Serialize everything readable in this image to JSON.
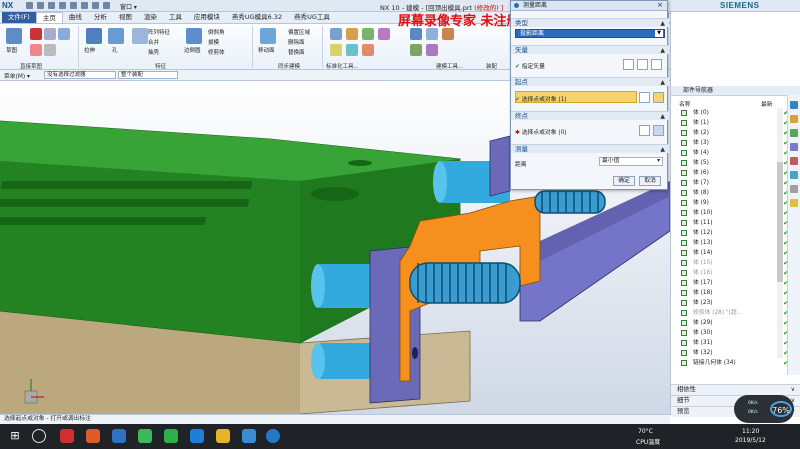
{
  "title_bar": {
    "logo": "NX",
    "window_menu": "窗口 ▾",
    "title": "NX 10 - 建模 - [",
    "filename": "回顶出模具.prt",
    "modified": "(修改的) ]",
    "brand": "SIEMENS"
  },
  "watermark": "屏幕录像专家  未注册",
  "menu_tabs": [
    "文件(F)",
    "主页",
    "曲线",
    "分析",
    "视图",
    "渲染",
    "工具",
    "应用模块",
    "燕秀UG模具6.32",
    "燕秀UG工具"
  ],
  "ribbon": {
    "buttons": [
      "草图",
      "拉伸",
      "孔",
      "阵列特征",
      "合并",
      "抽壳",
      "边倒圆",
      "倒斜角",
      "拔模",
      "修剪体",
      "同步建模",
      "移动面",
      "偏置区域",
      "删除面",
      "替换面"
    ],
    "groups": [
      "直接草图",
      "特征",
      "同步建模",
      "标准化工具...",
      "建模工具...",
      "装配"
    ]
  },
  "selection_bar": {
    "menu": "菜单(M) ▾",
    "filter": "没有选择过滤器",
    "scope": "整个装配"
  },
  "dialog": {
    "title": "测量距离",
    "type_section": "类型",
    "type_value": "投影距离",
    "vector_section": "矢量",
    "vector_row": "指定矢量",
    "start_section": "起点",
    "start_row": "选择点或对象 (1)",
    "end_section": "终点",
    "end_row": "选择点或对象 (0)",
    "measure_section": "测量",
    "distance_label": "距离",
    "distance_value": "最小值",
    "ok": "确定",
    "cancel": "取消"
  },
  "navigator": {
    "header": "部件导航器",
    "col_name": "名称",
    "col_latest": "最新",
    "items": [
      {
        "label": "体 (0)",
        "dim": false
      },
      {
        "label": "体 (1)",
        "dim": false
      },
      {
        "label": "体 (2)",
        "dim": false
      },
      {
        "label": "体 (3)",
        "dim": false
      },
      {
        "label": "体 (4)",
        "dim": false
      },
      {
        "label": "体 (5)",
        "dim": false
      },
      {
        "label": "体 (6)",
        "dim": false
      },
      {
        "label": "体 (7)",
        "dim": false
      },
      {
        "label": "体 (8)",
        "dim": false
      },
      {
        "label": "体 (9)",
        "dim": false
      },
      {
        "label": "体 (10)",
        "dim": false
      },
      {
        "label": "体 (11)",
        "dim": false
      },
      {
        "label": "体 (12)",
        "dim": false
      },
      {
        "label": "体 (13)",
        "dim": false
      },
      {
        "label": "体 (14)",
        "dim": false
      },
      {
        "label": "体 (15)",
        "dim": true
      },
      {
        "label": "体 (16)",
        "dim": true
      },
      {
        "label": "体 (17)",
        "dim": false
      },
      {
        "label": "体 (18)",
        "dim": false
      },
      {
        "label": "体 (23)",
        "dim": false
      },
      {
        "label": "修剪体 (28) \"(超...",
        "dim": true
      },
      {
        "label": "体 (29)",
        "dim": false
      },
      {
        "label": "体 (30)",
        "dim": false
      },
      {
        "label": "体 (31)",
        "dim": false
      },
      {
        "label": "体 (32)",
        "dim": false
      },
      {
        "label": "链接几何体 (34)",
        "dim": false
      }
    ],
    "footer_items": [
      "相依性",
      "细节",
      "预览"
    ]
  },
  "status_text": "选择起点或对象 - 打开或调出标注",
  "taskbar": {
    "temp": "70°C",
    "temp_label": "CPU温度",
    "time": "11:20",
    "date": "2019/5/12"
  },
  "speed_widget": {
    "percent": "76%",
    "up": "0K/s",
    "down": "0K/s"
  }
}
